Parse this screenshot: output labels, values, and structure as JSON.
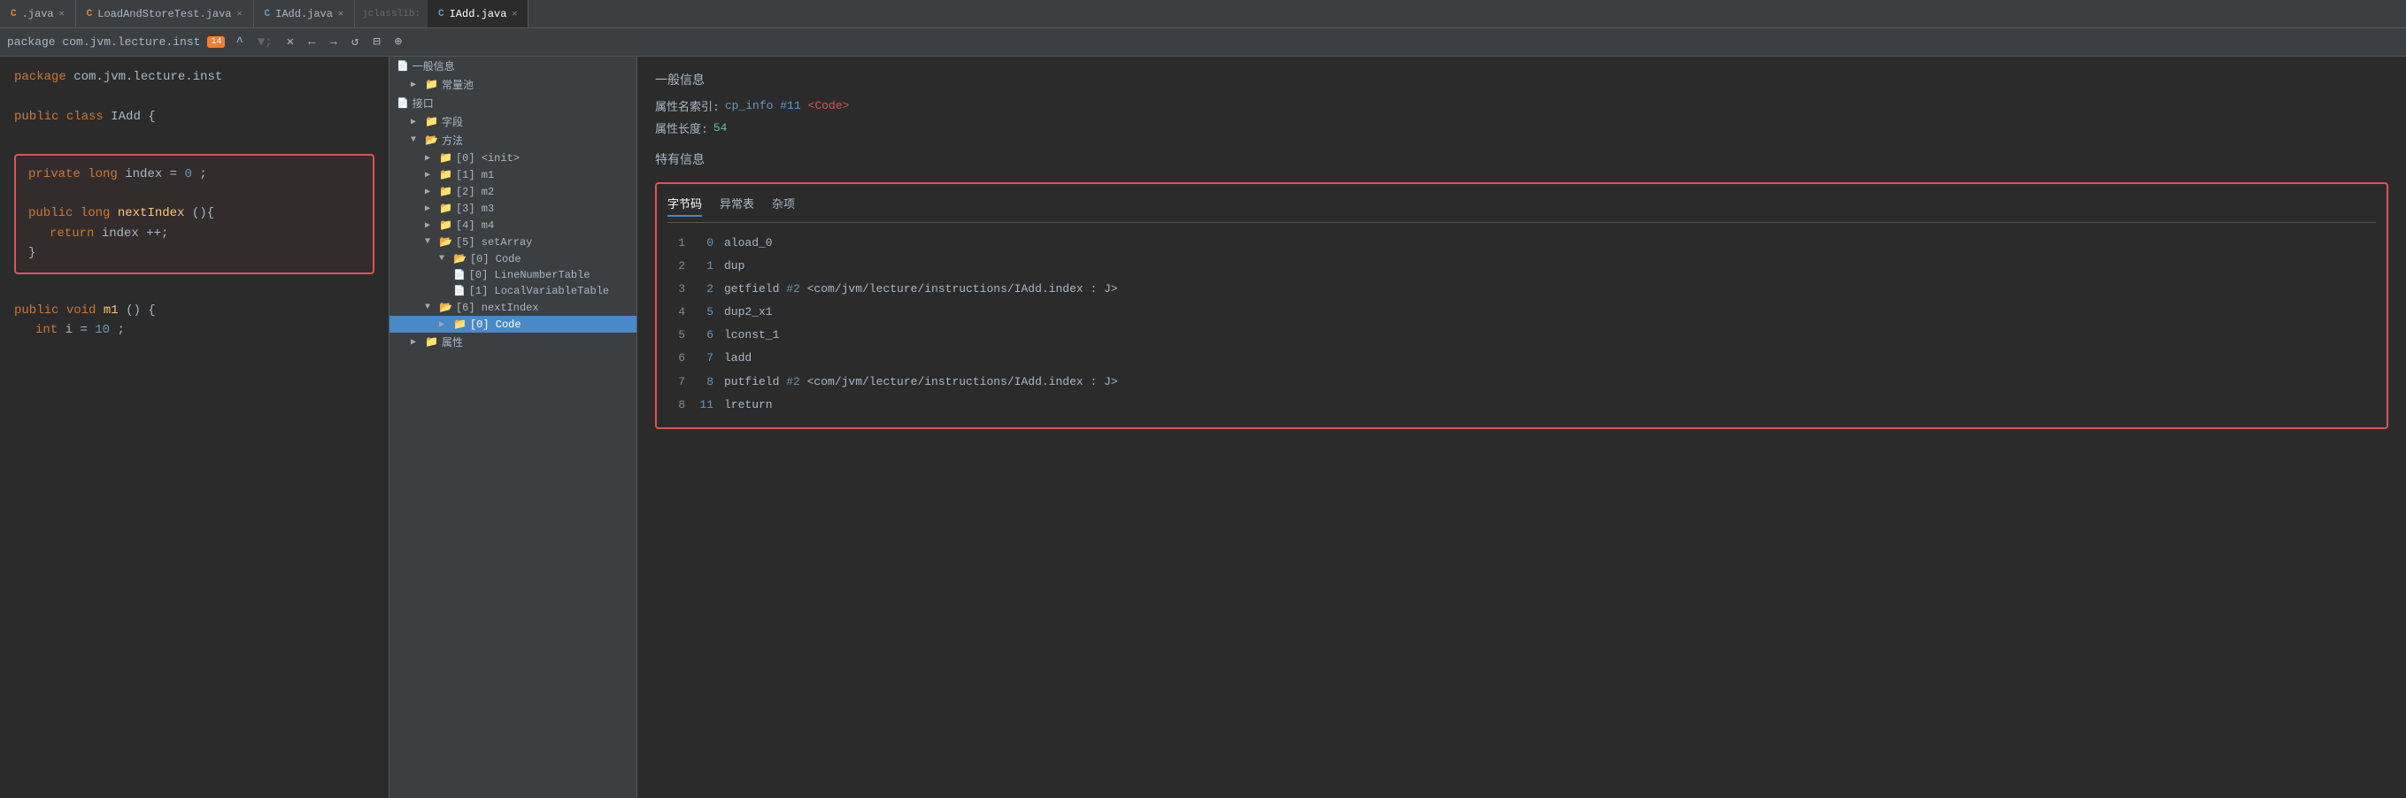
{
  "tabs": [
    {
      "label": ".java",
      "type": "java",
      "active": false,
      "closable": true
    },
    {
      "label": "LoadAndStoreTest.java",
      "type": "java",
      "active": false,
      "closable": true
    },
    {
      "label": "IAdd.java",
      "type": "class",
      "active": false,
      "closable": true
    },
    {
      "label": "jclasslib:",
      "separator": true
    },
    {
      "label": "IAdd.java",
      "type": "class",
      "active": true,
      "closable": true
    }
  ],
  "toolbar": {
    "package_text": "package com.jvm.lecture.inst",
    "warning_count": "14",
    "buttons": [
      "▲",
      "^",
      "▼",
      "✕",
      "←",
      "→",
      "↺",
      "⊟",
      "🌐"
    ]
  },
  "code": {
    "line1": "package com.jvm.lecture.inst",
    "line2": "",
    "line3": "public class IAdd {",
    "highlighted": {
      "line1": "    private long index = 0;",
      "line2": "",
      "line3": "    public long nextIndex(){",
      "line4": "        return index ++;",
      "line5": "    }"
    },
    "line4": "",
    "line5": "    public void m1() {",
    "line6": "        int i = 10;"
  },
  "tree": {
    "items": [
      {
        "label": "一般信息",
        "indent": 0,
        "type": "file",
        "expanded": false
      },
      {
        "label": "常量池",
        "indent": 0,
        "type": "folder",
        "expanded": false,
        "arrow": "▶"
      },
      {
        "label": "接口",
        "indent": 0,
        "type": "file",
        "expanded": false
      },
      {
        "label": "字段",
        "indent": 0,
        "type": "folder",
        "expanded": false,
        "arrow": "▶"
      },
      {
        "label": "方法",
        "indent": 0,
        "type": "folder",
        "expanded": true,
        "arrow": "▼"
      },
      {
        "label": "[0] <init>",
        "indent": 1,
        "type": "folder",
        "expanded": false,
        "arrow": "▶"
      },
      {
        "label": "[1] m1",
        "indent": 1,
        "type": "folder",
        "expanded": false,
        "arrow": "▶"
      },
      {
        "label": "[2] m2",
        "indent": 1,
        "type": "folder",
        "expanded": false,
        "arrow": "▶"
      },
      {
        "label": "[3] m3",
        "indent": 1,
        "type": "folder",
        "expanded": false,
        "arrow": "▶"
      },
      {
        "label": "[4] m4",
        "indent": 1,
        "type": "folder",
        "expanded": false,
        "arrow": "▶"
      },
      {
        "label": "[5] setArray",
        "indent": 1,
        "type": "folder",
        "expanded": true,
        "arrow": "▼"
      },
      {
        "label": "[0] Code",
        "indent": 2,
        "type": "folder",
        "expanded": true,
        "arrow": "▼"
      },
      {
        "label": "[0] LineNumberTable",
        "indent": 3,
        "type": "file"
      },
      {
        "label": "[1] LocalVariableTable",
        "indent": 3,
        "type": "file"
      },
      {
        "label": "[6] nextIndex",
        "indent": 1,
        "type": "folder",
        "expanded": true,
        "arrow": "▼"
      },
      {
        "label": "[0] Code",
        "indent": 2,
        "type": "folder",
        "expanded": false,
        "arrow": "▶",
        "selected": true
      },
      {
        "label": "属性",
        "indent": 0,
        "type": "folder",
        "expanded": false,
        "arrow": "▶"
      }
    ]
  },
  "detail": {
    "general_title": "一般信息",
    "attr_name_label": "属性名索引:",
    "attr_name_link": "cp_info #11",
    "attr_name_tag": "<Code>",
    "attr_length_label": "属性长度:",
    "attr_length_value": "54",
    "specific_title": "特有信息",
    "tabs": [
      {
        "label": "字节码",
        "active": true
      },
      {
        "label": "异常表",
        "active": false
      },
      {
        "label": "杂项",
        "active": false
      }
    ],
    "bytecodes": [
      {
        "line": "1",
        "offset": "0",
        "instruction": "aload_0",
        "ref": "",
        "detail": ""
      },
      {
        "line": "2",
        "offset": "1",
        "instruction": "dup",
        "ref": "",
        "detail": ""
      },
      {
        "line": "3",
        "offset": "2",
        "instruction": "getfield",
        "ref": "#2",
        "detail": " <com/jvm/lecture/instructions/IAdd.index : J>"
      },
      {
        "line": "4",
        "offset": "5",
        "instruction": "dup2_x1",
        "ref": "",
        "detail": ""
      },
      {
        "line": "5",
        "offset": "6",
        "instruction": "lconst_1",
        "ref": "",
        "detail": ""
      },
      {
        "line": "6",
        "offset": "7",
        "instruction": "ladd",
        "ref": "",
        "detail": ""
      },
      {
        "line": "7",
        "offset": "8",
        "instruction": "putfield",
        "ref": "#2",
        "detail": " <com/jvm/lecture/instructions/IAdd.index : J>"
      },
      {
        "line": "8",
        "offset": "11",
        "instruction": "lreturn",
        "ref": "",
        "detail": ""
      }
    ]
  }
}
